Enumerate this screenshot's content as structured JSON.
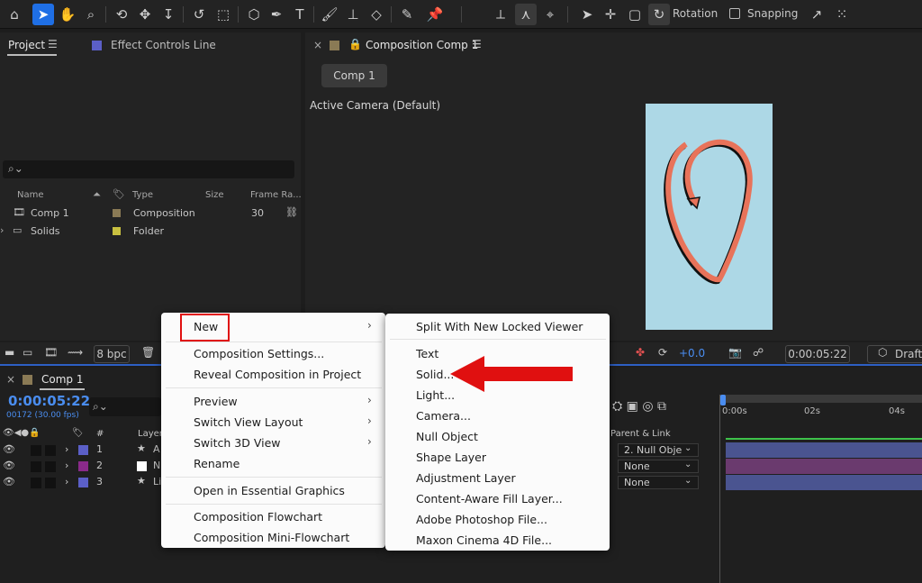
{
  "toolbar": {
    "rotation_label": "Rotation",
    "snapping_label": "Snapping"
  },
  "project_panel": {
    "tab_project": "Project",
    "tab_effect_controls": "Effect Controls Line",
    "columns": {
      "name": "Name",
      "type": "Type",
      "size": "Size",
      "frame_rate": "Frame Ra..."
    },
    "items": [
      {
        "name": "Comp 1",
        "type": "Composition",
        "frame_rate": "30",
        "color": "#8a7a55"
      },
      {
        "name": "Solids",
        "type": "Folder",
        "frame_rate": "",
        "color": "#c8c040"
      }
    ]
  },
  "comp_panel": {
    "tab_title": "Composition Comp 1",
    "chip": "Comp 1",
    "camera_label": "Active Camera (Default)"
  },
  "viewer_bar": {
    "bit_depth": "8 bpc",
    "exposure": "+0.0",
    "timecode": "0:00:05:22",
    "draft": "Draft"
  },
  "timeline": {
    "tab_title": "Comp 1",
    "timecode": "0:00:05:22",
    "frame_info": "00172 (30.00 fps)",
    "col_num": "#",
    "col_layer": "Layer",
    "col_parent": "Parent & Link",
    "ruler": [
      "0:00s",
      "02s",
      "04s"
    ],
    "layers": [
      {
        "num": "1",
        "name": "A",
        "label_color": "#5b5fc7",
        "parent": "2. Null Obje",
        "bar_color": "#4a5490"
      },
      {
        "num": "2",
        "name": "N",
        "label_color": "#8a2a8a",
        "parent": "None",
        "bar_color": "#6a3a6e"
      },
      {
        "num": "3",
        "name": "Li",
        "label_color": "#5b5fc7",
        "parent": "None",
        "bar_color": "#4a5490"
      }
    ]
  },
  "context_menu": {
    "items": [
      {
        "label": "New",
        "submenu": true
      },
      {
        "label": "Composition Settings..."
      },
      {
        "label": "Reveal Composition in Project"
      },
      {
        "label": "Preview",
        "submenu": true
      },
      {
        "label": "Switch View Layout",
        "submenu": true
      },
      {
        "label": "Switch 3D View",
        "submenu": true
      },
      {
        "label": "Rename"
      },
      {
        "label": "Open in Essential Graphics"
      },
      {
        "label": "Composition Flowchart"
      },
      {
        "label": "Composition Mini-Flowchart"
      }
    ]
  },
  "submenu": {
    "items": [
      {
        "label": "Split With New Locked Viewer"
      },
      {
        "label": "Text"
      },
      {
        "label": "Solid..."
      },
      {
        "label": "Light..."
      },
      {
        "label": "Camera..."
      },
      {
        "label": "Null Object"
      },
      {
        "label": "Shape Layer"
      },
      {
        "label": "Adjustment Layer"
      },
      {
        "label": "Content-Aware Fill Layer..."
      },
      {
        "label": "Adobe Photoshop File..."
      },
      {
        "label": "Maxon Cinema 4D File..."
      }
    ]
  },
  "colors": {
    "accent_blue": "#1f6fe5",
    "timecode_blue": "#4a8df0",
    "annotation_red": "#e01010",
    "comp_bg": "#add8e6",
    "stroke_orange": "#e8735a"
  }
}
